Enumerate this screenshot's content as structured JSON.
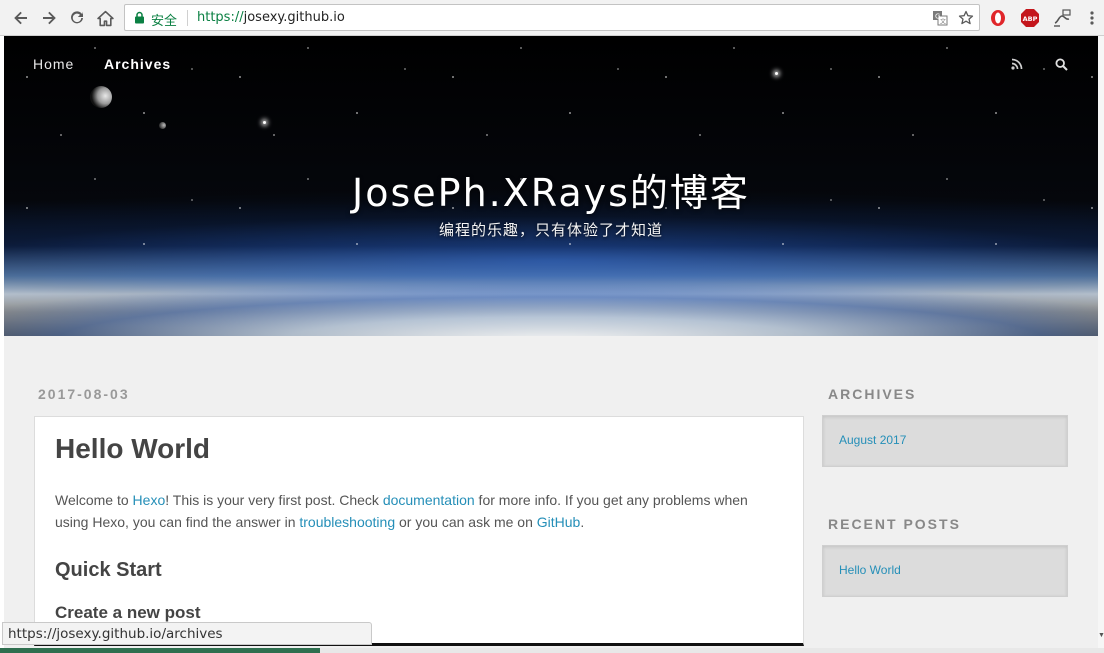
{
  "browser": {
    "security_label": "安全",
    "url_scheme": "https://",
    "url_host": "josexy.github.io",
    "icons": [
      "back-arrow-icon",
      "forward-arrow-icon",
      "reload-icon",
      "home-icon",
      "lock-icon",
      "translate-icon",
      "star-icon",
      "opera-icon",
      "adblock-icon",
      "extension-icon",
      "menu-dots-icon"
    ],
    "adblock_label": "ABP",
    "accent_green": "#0b8043"
  },
  "site": {
    "nav": [
      {
        "label": "Home"
      },
      {
        "label": "Archives"
      }
    ],
    "title": "JosePh.XRays的博客",
    "subtitle": "编程的乐趣，只有体验了才知道",
    "link_color": "#258fb8"
  },
  "post": {
    "date": "2017-08-03",
    "title": "Hello World",
    "intro_1": "Welcome to ",
    "link_hexo": "Hexo",
    "intro_2": "! This is your very first post. Check ",
    "link_docs": "documentation",
    "intro_3": " for more info. If you get any problems when using Hexo, you can find the answer in ",
    "link_trouble": "troubleshooting",
    "intro_4": " or you can ask me on ",
    "link_github": "GitHub",
    "intro_5": ".",
    "heading_quick_start": "Quick Start",
    "heading_create_post": "Create a new post"
  },
  "sidebar": {
    "archives_title": "ARCHIVES",
    "archives_items": [
      {
        "label": "August 2017"
      }
    ],
    "recent_title": "RECENT POSTS",
    "recent_items": [
      {
        "label": "Hello World"
      }
    ]
  },
  "status_bar": {
    "url": "https://josexy.github.io/archives"
  }
}
